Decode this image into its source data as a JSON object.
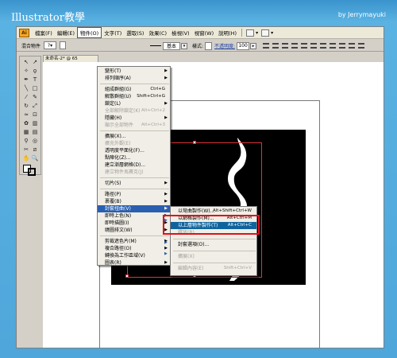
{
  "banner": {
    "title": "Illustrator教學",
    "author": "by Jerrymayuki"
  },
  "menubar": {
    "logo": "Ai",
    "items": [
      "檔案(F)",
      "編輯(E)",
      "物件(O)",
      "文字(T)",
      "選取(S)",
      "效果(C)",
      "檢視(V)",
      "視窗(W)",
      "說明(H)"
    ],
    "active_index": 2
  },
  "control_bar": {
    "label": "混合物件",
    "stroke_style": "基本",
    "style_label": "樣式:",
    "opacity_label": "不透明度:",
    "opacity_value": "100"
  },
  "document_tab": {
    "label": "未命名-2* @ 65"
  },
  "object_menu": {
    "items": [
      {
        "label": "變形(T)",
        "submenu": true
      },
      {
        "label": "排列順序(A)",
        "submenu": true
      },
      {
        "label": "組成群組(G)",
        "shortcut": "Ctrl+G"
      },
      {
        "label": "解散群組(U)",
        "shortcut": "Shift+Ctrl+G"
      },
      {
        "label": "鎖定(L)",
        "submenu": true
      },
      {
        "label": "全部解除鎖定(K)",
        "shortcut": "Alt+Ctrl+2",
        "disabled": true
      },
      {
        "label": "隱藏(H)",
        "submenu": true
      },
      {
        "label": "顯示全部物件",
        "shortcut": "Alt+Ctrl+3",
        "disabled": true
      },
      {
        "label": "擴展(X)..."
      },
      {
        "label": "擴充外觀(E)",
        "disabled": true
      },
      {
        "label": "透明度平面化(F)..."
      },
      {
        "label": "點陣化(Z)..."
      },
      {
        "label": "建立漸層網格(D)..."
      },
      {
        "label": "建立物件馬賽克(J)",
        "disabled": true
      },
      {
        "label": "切片(S)",
        "submenu": true
      },
      {
        "label": "路徑(P)",
        "submenu": true
      },
      {
        "label": "裹覆(B)",
        "submenu": true
      },
      {
        "label": "封套扭曲(V)",
        "submenu": true,
        "highlighted": true
      },
      {
        "label": "即時上色(N)",
        "submenu": true
      },
      {
        "label": "即時描圖(I)",
        "submenu": true
      },
      {
        "label": "繞圖排文(W)",
        "submenu": true
      },
      {
        "label": "剪裁遮色片(M)",
        "submenu": true
      },
      {
        "label": "複合路徑(O)",
        "submenu": true
      },
      {
        "label": "轉換為工作區域(V)"
      },
      {
        "label": "圖表(R)",
        "submenu": true
      }
    ]
  },
  "envelope_submenu": {
    "items": [
      {
        "label": "以彎曲製作(W)...",
        "shortcut": "Alt+Shift+Ctrl+W"
      },
      {
        "label": "以網格製作(M)...",
        "shortcut": "Alt+Ctrl+M"
      },
      {
        "label": "以上層物件製作(T)",
        "shortcut": "Alt+Ctrl+C",
        "highlighted": true
      },
      {
        "label": "釋放(R)",
        "disabled": true
      },
      {
        "label": "封套選項(O)..."
      },
      {
        "label": "擴展(X)",
        "disabled": true
      },
      {
        "label": "編輯內容(E)",
        "shortcut": "Shift+Ctrl+V",
        "disabled": true
      }
    ]
  },
  "colors": {
    "banner": "#4ea6da",
    "menu_highlight": "#2a5fb0",
    "callout_red": "#e0101a",
    "artwork": "#000000"
  }
}
